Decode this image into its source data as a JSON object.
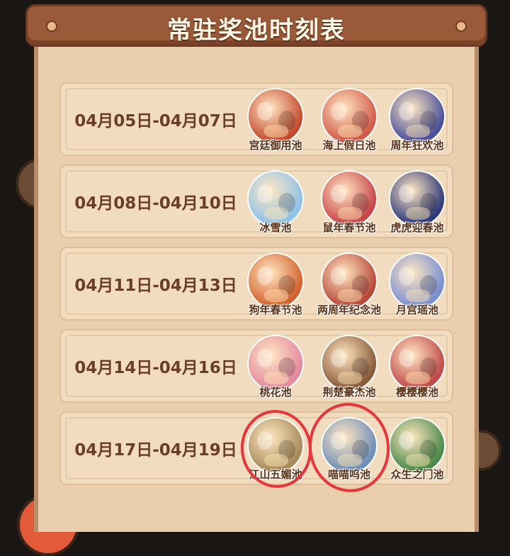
{
  "title": "常驻奖池时刻表",
  "rows": [
    {
      "date": "04月05日-04月07日",
      "pools": [
        {
          "name": "宫廷御用池",
          "color": "#c44a2e"
        },
        {
          "name": "海上假日池",
          "color": "#d25a4a"
        },
        {
          "name": "周年狂欢池",
          "color": "#4a4f9a"
        }
      ]
    },
    {
      "date": "04月08日-04月10日",
      "pools": [
        {
          "name": "冰雪池",
          "color": "#8fc2e8"
        },
        {
          "name": "鼠年春节池",
          "color": "#c8454a"
        },
        {
          "name": "虎虎迎春池",
          "color": "#2f3a7a"
        }
      ]
    },
    {
      "date": "04月11日-04月13日",
      "pools": [
        {
          "name": "狗年春节池",
          "color": "#d4622e"
        },
        {
          "name": "两周年纪念池",
          "color": "#b8483a"
        },
        {
          "name": "月宫瑶池",
          "color": "#7a8fd2"
        }
      ]
    },
    {
      "date": "04月14日-04月16日",
      "pools": [
        {
          "name": "桃花池",
          "color": "#e48aa0"
        },
        {
          "name": "荆楚豪杰池",
          "color": "#8a5a3a"
        },
        {
          "name": "樱樱樱池",
          "color": "#c04a4a"
        }
      ]
    },
    {
      "date": "04月17日-04月19日",
      "pools": [
        {
          "name": "江山五媚池",
          "color": "#a88a5a"
        },
        {
          "name": "喵喵呜池",
          "color": "#6f8fb8"
        },
        {
          "name": "众生之门池",
          "color": "#4a8a4a"
        }
      ]
    }
  ]
}
